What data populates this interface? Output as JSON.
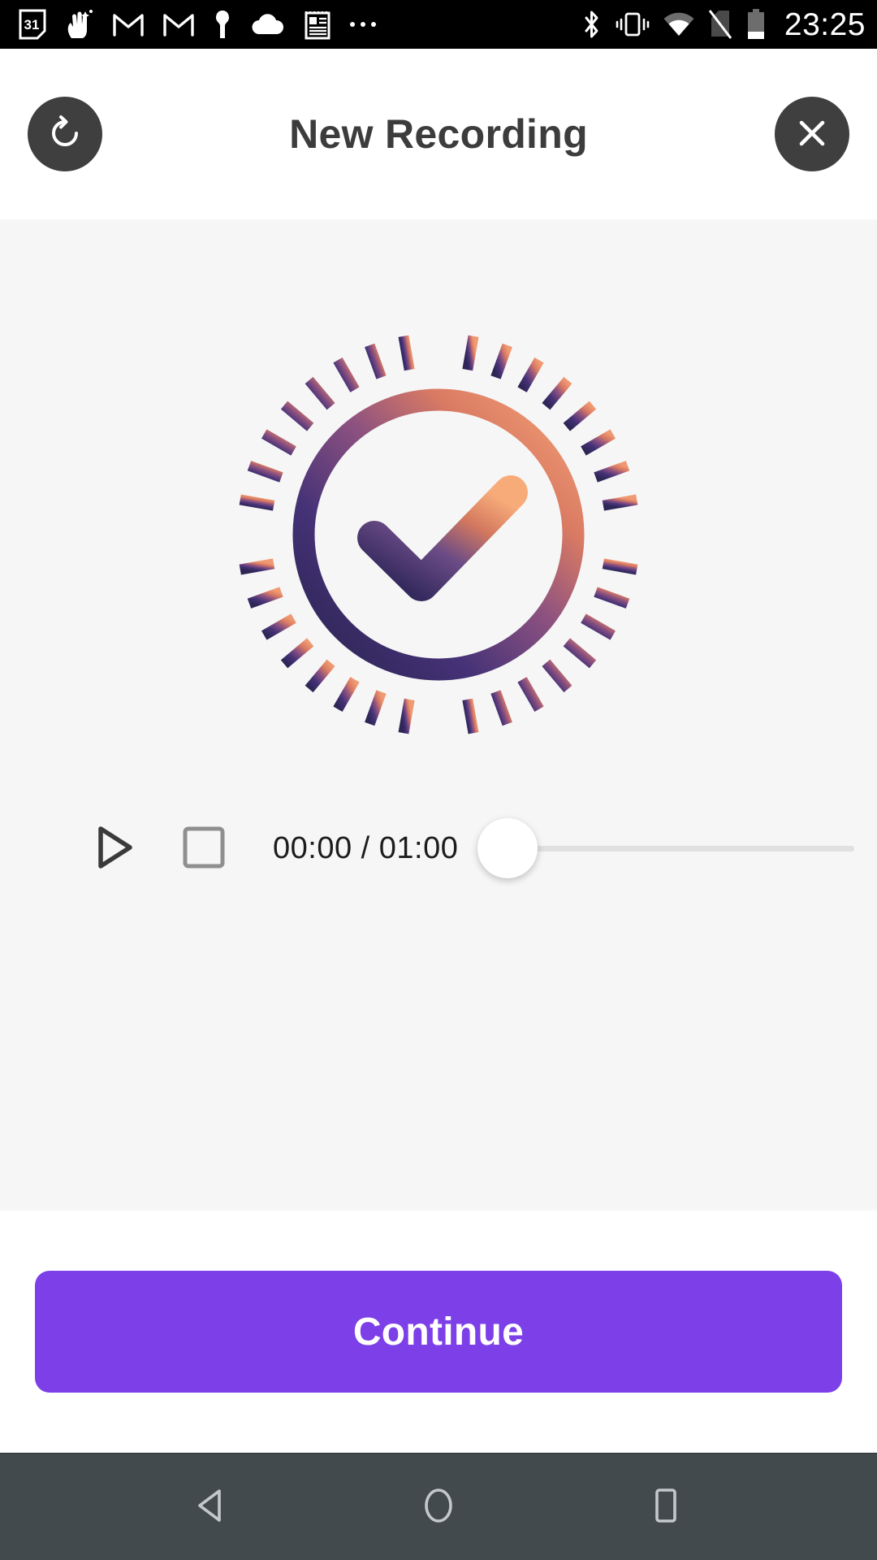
{
  "status_bar": {
    "time": "23:25",
    "left_icons": [
      {
        "name": "calendar-icon",
        "label": "31"
      },
      {
        "name": "sparkle-hand-icon",
        "label": ""
      },
      {
        "name": "gmail-icon",
        "label": ""
      },
      {
        "name": "gmail-alt-icon",
        "label": ""
      },
      {
        "name": "keyhole-icon",
        "label": ""
      },
      {
        "name": "cloud-icon",
        "label": ""
      },
      {
        "name": "notes-icon",
        "label": ""
      },
      {
        "name": "more-dots-icon",
        "label": ""
      }
    ],
    "right_icons": [
      {
        "name": "bluetooth-icon"
      },
      {
        "name": "vibrate-icon"
      },
      {
        "name": "wifi-icon"
      },
      {
        "name": "sim-off-icon"
      },
      {
        "name": "battery-icon"
      }
    ]
  },
  "header": {
    "title": "New Recording",
    "refresh_label": "Restart recording",
    "close_label": "Close"
  },
  "content": {
    "illustration": {
      "name": "success-check-burst",
      "gradient_start": "#e8886b",
      "gradient_end": "#342a5e",
      "tick_count": 36
    }
  },
  "player": {
    "play_label": "Play",
    "stop_label": "Stop",
    "time_display": "00:00 / 01:00",
    "current_time": "00:00",
    "total_time": "01:00",
    "progress_percent": 0
  },
  "footer": {
    "continue_label": "Continue",
    "accent_color": "#7c3fe8"
  },
  "nav_bar": {
    "back_label": "Back",
    "home_label": "Home",
    "recents_label": "Recent apps"
  }
}
